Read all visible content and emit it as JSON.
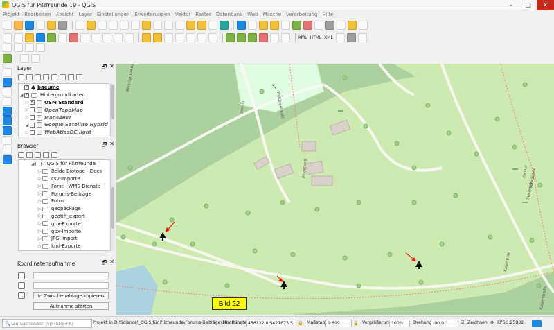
{
  "window": {
    "title": "QGIS für Pilzfreunde 19 - QGIS"
  },
  "menu": [
    "Projekt",
    "Bearbeiten",
    "Ansicht",
    "Layer",
    "Einstellungen",
    "Erweiterungen",
    "Vektor",
    "Raster",
    "Datenbank",
    "Web",
    "Masche",
    "Verarbeitung",
    "Hilfe"
  ],
  "toolbar2_labels": {
    "kml": "KML",
    "html": "HTML",
    "xml": "XML"
  },
  "layers_panel": {
    "title": "Layer",
    "items": [
      {
        "label": "baeume",
        "checked": true,
        "style": "bold-underline"
      },
      {
        "label": "Hintergrundkarten",
        "checked": true,
        "style": "normal"
      },
      {
        "label": "OSM Standard",
        "checked": true,
        "style": "bold"
      },
      {
        "label": "OpenTopoMap",
        "checked": false,
        "style": "italic"
      },
      {
        "label": "Maps4BW",
        "checked": false,
        "style": "italic"
      },
      {
        "label": "Google Satellite Hybrid",
        "checked": false,
        "style": "italic"
      },
      {
        "label": "WebAtlasDE.light",
        "checked": false,
        "style": "italic"
      }
    ]
  },
  "browser_panel": {
    "title": "Browser",
    "root": "_QGIS für Pilzfreunde",
    "items": [
      "Beide Biotope - Docs",
      "csv-Importe",
      "Forst - WMS-Dienste",
      "Forums-Beiträge",
      "Fotos",
      "geopackage",
      "geotiff_export",
      "gpx-Exporte",
      "gpx-Importe",
      "JPG-Import",
      "kml-Exporte"
    ]
  },
  "coord_panel": {
    "title": "Koordinatenaufnahme",
    "copy_button": "In Zwischenablage kopieren",
    "start_button": "Aufnahme starten"
  },
  "map": {
    "label": "Bild 22",
    "street_labels": [
      "Kieselgrube mit Ziegelbrock",
      "Waldspielplatz",
      "Jasmin",
      "Pingelweg",
      "Kleiner",
      "Vorwäldele",
      "Kaiserpfad",
      "Kaiserstraße",
      "Stauwerk"
    ]
  },
  "status": {
    "search_placeholder": "Zu suchender Typ (Strg+K)",
    "project_path": "Projekt in D:\\Science\\_QGIS für Pilzfreunde\\Forums-Beiträge\\19 - Pun",
    "coord_label": "Koordinate",
    "coord_value": "456132.0,5427673.5",
    "scale_label": "Maßstab",
    "scale_value": "1:699",
    "magnify_label": "Vergrößerung",
    "magnify_value": "100%",
    "rotation_label": "Drehung",
    "rotation_value": "-90,0 °",
    "render_label": "Zeichnen",
    "crs": "EPSG:25832"
  },
  "colors": {
    "map_bg": "#add19e",
    "grass": "#cdebb0",
    "path": "#fa8072",
    "label_bg": "#ffff00",
    "pointer": "#ff0000"
  }
}
